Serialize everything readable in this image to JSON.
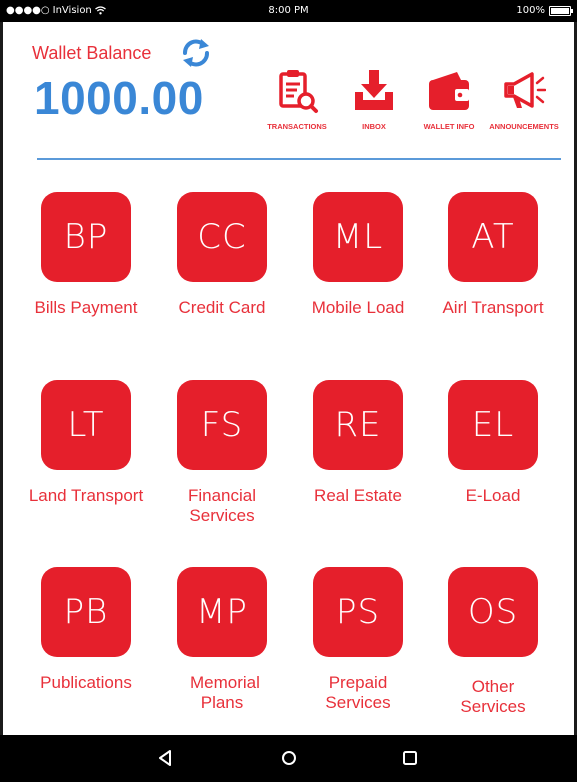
{
  "status_bar": {
    "carrier": "InVision",
    "time": "8:00 PM",
    "battery": "100%"
  },
  "header": {
    "balance_label": "Wallet Balance",
    "balance_value": "1000.00",
    "actions": [
      {
        "label": "TRANSACTIONS",
        "icon": "transactions-icon"
      },
      {
        "label": "INBOX",
        "icon": "inbox-icon"
      },
      {
        "label": "WALLET INFO",
        "icon": "wallet-icon"
      },
      {
        "label": "ANNOUNCEMENTS",
        "icon": "megaphone-icon"
      }
    ]
  },
  "services": [
    {
      "abbr": "BP",
      "label": "Bills Payment"
    },
    {
      "abbr": "CC",
      "label": "Credit Card"
    },
    {
      "abbr": "ML",
      "label": "Mobile Load"
    },
    {
      "abbr": "AT",
      "label": "Airl Transport"
    },
    {
      "abbr": "LT",
      "label": "Land Transport"
    },
    {
      "abbr": "FS",
      "label": "Financial Services"
    },
    {
      "abbr": "RE",
      "label": "Real Estate"
    },
    {
      "abbr": "EL",
      "label": "E-Load"
    },
    {
      "abbr": "PB",
      "label": "Publications"
    },
    {
      "abbr": "MP",
      "label": "Memorial Plans"
    },
    {
      "abbr": "PS",
      "label": "Prepaid Services"
    },
    {
      "abbr": "OS",
      "label": "Other Services"
    }
  ],
  "colors": {
    "accent_red": "#e51f2b",
    "balance_blue": "#3a87d6"
  }
}
